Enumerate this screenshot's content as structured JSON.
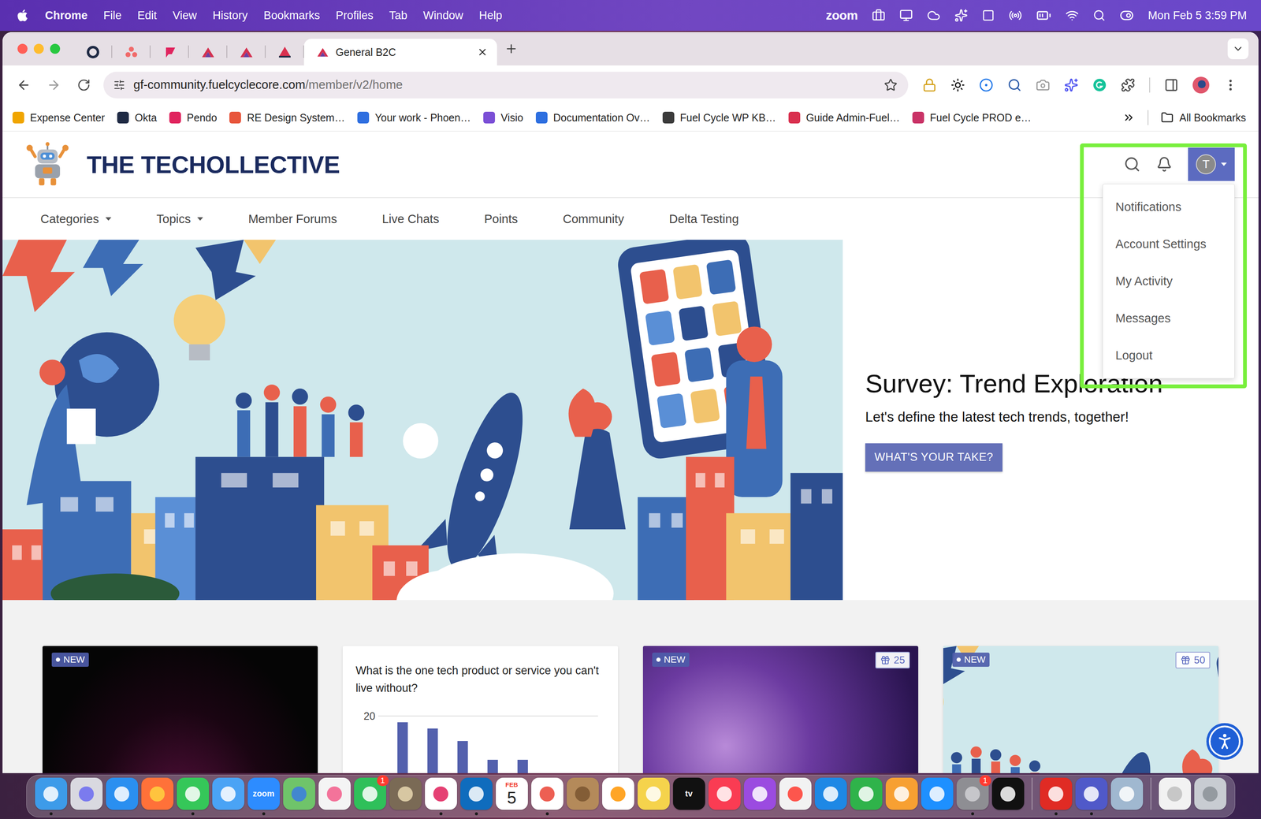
{
  "menu_bar": {
    "app": "Chrome",
    "menus": [
      "File",
      "Edit",
      "View",
      "History",
      "Bookmarks",
      "Profiles",
      "Tab",
      "Window",
      "Help"
    ],
    "status": "zoom",
    "clock": "Mon Feb 5 3:59 PM"
  },
  "browser": {
    "tabs": [
      {
        "pinned": true,
        "selected": false
      },
      {
        "pinned": true,
        "selected": false
      },
      {
        "pinned": true,
        "selected": false
      },
      {
        "pinned": true,
        "selected": false
      },
      {
        "pinned": true,
        "selected": false
      },
      {
        "pinned": true,
        "selected": false
      },
      {
        "pinned": false,
        "label": "General B2C",
        "selected": true
      }
    ],
    "url": {
      "host": "gf-community.fuelcyclecore.com",
      "path": "/member/v2/home"
    },
    "bookmarks": [
      "Expense Center",
      "Okta",
      "Pendo",
      "RE Design System…",
      "Your work - Phoen…",
      "Visio",
      "Documentation Ov…",
      "Fuel Cycle WP KB…",
      "Guide Admin-Fuel…",
      "Fuel Cycle PROD e…"
    ],
    "all_bookmarks": "All Bookmarks"
  },
  "page": {
    "brand": "THE TECHOLLECTIVE",
    "user_menu": {
      "avatar": "T",
      "expanded": true,
      "items": [
        "Notifications",
        "Account Settings",
        "My Activity",
        "Messages",
        "Logout"
      ]
    },
    "nav": [
      {
        "label": "Categories",
        "dropdown": true
      },
      {
        "label": "Topics",
        "dropdown": true
      },
      {
        "label": "Member Forums",
        "dropdown": false
      },
      {
        "label": "Live Chats",
        "dropdown": false
      },
      {
        "label": "Points",
        "dropdown": false
      },
      {
        "label": "Community",
        "dropdown": false
      },
      {
        "label": "Delta Testing",
        "dropdown": false
      }
    ],
    "hero": {
      "title": "Survey: Trend Exploration",
      "subtitle": "Let's define the latest tech trends, together!",
      "button": "WHAT'S YOUR TAKE?"
    },
    "cards": [
      {
        "kind": "neon",
        "tag": "NEW"
      },
      {
        "kind": "chart",
        "title": "What is the one tech product or service you can't live without?",
        "ticks": [
          "20"
        ],
        "values": [
          19,
          18,
          16,
          13,
          13
        ]
      },
      {
        "kind": "bokeh",
        "tag": "NEW",
        "points": "25"
      },
      {
        "kind": "illustration",
        "tag": "NEW",
        "points": "50"
      }
    ]
  },
  "dock": {
    "items": [
      {
        "kind": "app",
        "running": true
      },
      {
        "kind": "app",
        "running": false
      },
      {
        "kind": "app",
        "running": false
      },
      {
        "kind": "app",
        "running": false
      },
      {
        "kind": "app",
        "running": true
      },
      {
        "kind": "app",
        "running": false
      },
      {
        "kind": "app",
        "running": true,
        "label": "zoom"
      },
      {
        "kind": "app",
        "running": false
      },
      {
        "kind": "app",
        "running": false
      },
      {
        "kind": "app",
        "running": false,
        "badge": "1"
      },
      {
        "kind": "app",
        "running": false
      },
      {
        "kind": "app",
        "running": true
      },
      {
        "kind": "app",
        "running": true
      },
      {
        "kind": "calendar",
        "running": false,
        "month": "FEB",
        "day": "5"
      },
      {
        "kind": "app",
        "running": true
      },
      {
        "kind": "app",
        "running": false
      },
      {
        "kind": "app",
        "running": false
      },
      {
        "kind": "app",
        "running": false
      },
      {
        "kind": "app",
        "running": false,
        "label": "tv"
      },
      {
        "kind": "app",
        "running": false
      },
      {
        "kind": "app",
        "running": false
      },
      {
        "kind": "app",
        "running": false
      },
      {
        "kind": "app",
        "running": false
      },
      {
        "kind": "app",
        "running": false
      },
      {
        "kind": "app",
        "running": false
      },
      {
        "kind": "app",
        "running": false
      },
      {
        "kind": "app",
        "running": true,
        "badge": "1"
      },
      {
        "kind": "app",
        "running": false
      },
      {
        "kind": "divider"
      },
      {
        "kind": "app",
        "running": true
      },
      {
        "kind": "app",
        "running": true
      },
      {
        "kind": "app",
        "running": false
      },
      {
        "kind": "divider"
      },
      {
        "kind": "app",
        "running": false
      },
      {
        "kind": "app",
        "running": false
      }
    ]
  }
}
